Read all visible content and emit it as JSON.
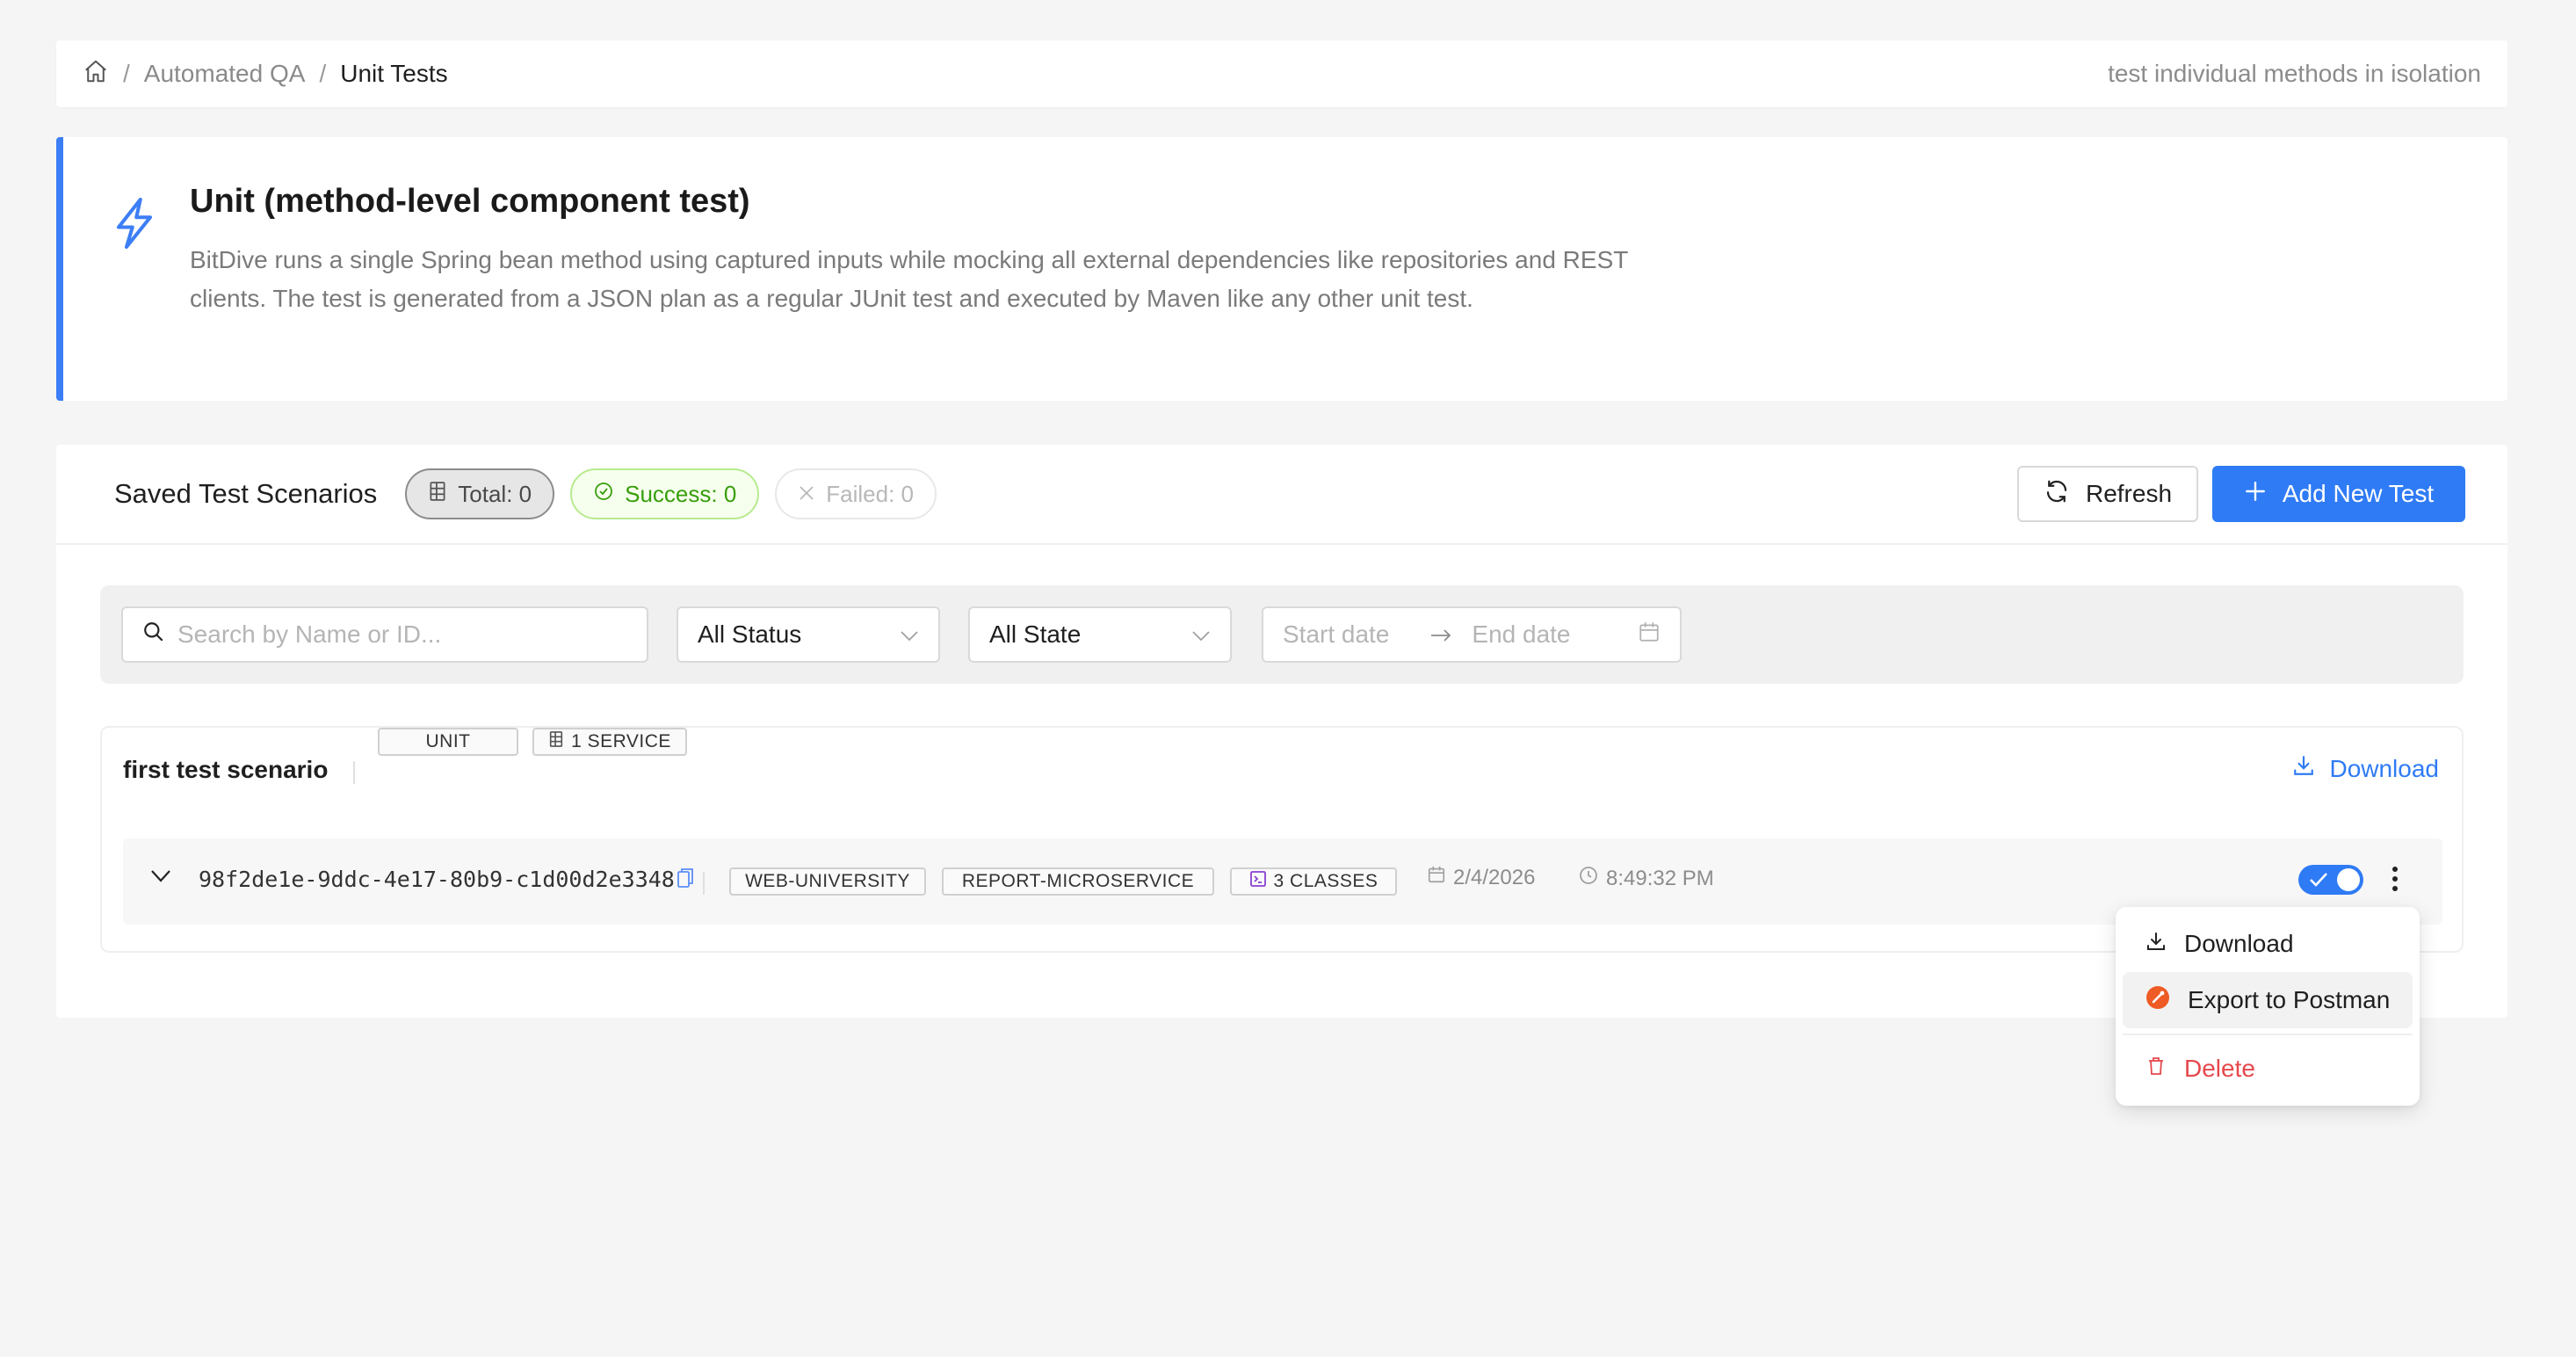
{
  "breadcrumb": {
    "items": [
      "Automated QA",
      "Unit Tests"
    ],
    "separator": "/",
    "description": "test individual methods in isolation"
  },
  "info": {
    "title": "Unit (method-level component test)",
    "body": "BitDive runs a single Spring bean method using captured inputs while mocking all external dependencies like repositories and REST clients. The test is generated from a JSON plan as a regular JUnit test and executed by Maven like any other unit test.",
    "accent_color": "#3c7ef6",
    "icon": "lightning-icon"
  },
  "panel": {
    "title": "Saved Test Scenarios",
    "stats": {
      "total": "Total: 0",
      "success": "Success: 0",
      "failed": "Failed: 0"
    },
    "refresh_label": "Refresh",
    "add_label": "Add New Test",
    "primary_color": "#2f7bf5"
  },
  "filters": {
    "search_placeholder": "Search by Name or ID...",
    "status_value": "All Status",
    "state_value": "All State",
    "start_placeholder": "Start date",
    "end_placeholder": "End date"
  },
  "scenario": {
    "name": "first test scenario",
    "type_tag": "UNIT",
    "service_tag": "1 SERVICE",
    "download_label": "Download",
    "run": {
      "id": "98f2de1e-9ddc-4e17-80b9-c1d00d2e3348",
      "tags": [
        "WEB-UNIVERSITY",
        "REPORT-MICROSERVICE"
      ],
      "classes_tag": "3 CLASSES",
      "date": "2/4/2026",
      "time": "8:49:32 PM",
      "enabled": true
    }
  },
  "menu": {
    "download": "Download",
    "export": "Export to Postman",
    "delete": "Delete",
    "danger_color": "#e5484d",
    "postman_color": "#ef5b25"
  }
}
